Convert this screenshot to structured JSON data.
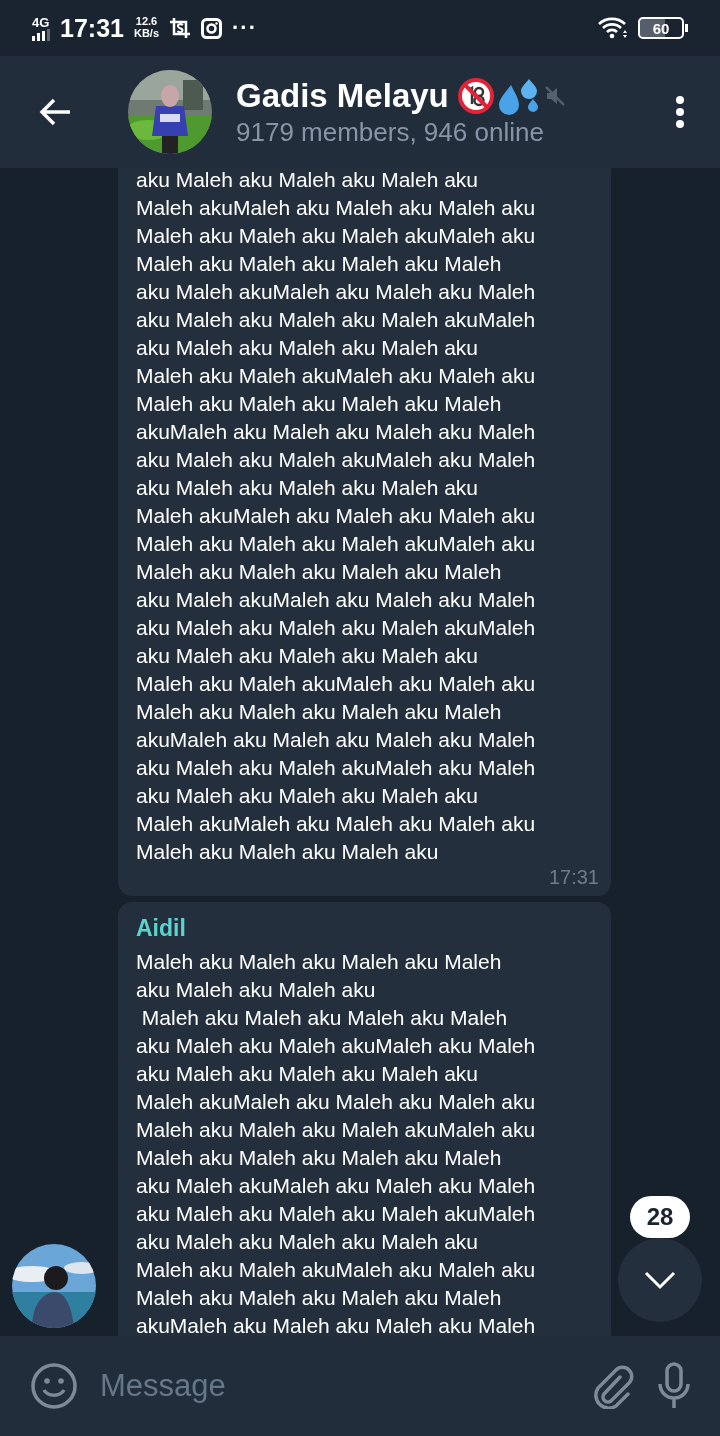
{
  "status_bar": {
    "network": "4G",
    "time": "17:31",
    "speed_value": "12.6",
    "speed_unit": "KB/s",
    "more": "···",
    "battery": "60"
  },
  "header": {
    "title": "Gadis Melayu",
    "subtitle": "9179 members, 946 online",
    "muted": true
  },
  "messages": [
    {
      "lines": [
        "aku Maleh aku Maleh aku Maleh aku",
        "Maleh akuMaleh aku Maleh aku Maleh aku",
        "Maleh aku Maleh aku Maleh akuMaleh aku",
        "Maleh aku Maleh aku Maleh aku Maleh",
        "aku Maleh akuMaleh aku Maleh aku Maleh",
        "aku Maleh aku Maleh aku Maleh akuMaleh",
        "aku Maleh aku Maleh aku Maleh aku",
        "Maleh aku Maleh akuMaleh aku Maleh aku",
        "Maleh aku Maleh aku Maleh aku Maleh",
        "akuMaleh aku Maleh aku Maleh aku Maleh",
        "aku Maleh aku Maleh akuMaleh aku Maleh",
        "aku Maleh aku Maleh aku Maleh aku",
        "Maleh akuMaleh aku Maleh aku Maleh aku",
        "Maleh aku Maleh aku Maleh akuMaleh aku",
        "Maleh aku Maleh aku Maleh aku Maleh",
        "aku Maleh akuMaleh aku Maleh aku Maleh",
        "aku Maleh aku Maleh aku Maleh akuMaleh",
        "aku Maleh aku Maleh aku Maleh aku",
        "Maleh aku Maleh akuMaleh aku Maleh aku",
        "Maleh aku Maleh aku Maleh aku Maleh",
        "akuMaleh aku Maleh aku Maleh aku Maleh",
        "aku Maleh aku Maleh akuMaleh aku Maleh",
        "aku Maleh aku Maleh aku Maleh aku",
        "Maleh akuMaleh aku Maleh aku Maleh aku",
        "Maleh aku Maleh aku Maleh aku"
      ],
      "time": "17:31"
    },
    {
      "sender": "Aidil",
      "lines": [
        "Maleh aku Maleh aku Maleh aku Maleh",
        "aku Maleh aku Maleh aku",
        " Maleh aku Maleh aku Maleh aku Maleh",
        "aku Maleh aku Maleh akuMaleh aku Maleh",
        "aku Maleh aku Maleh aku Maleh aku",
        "Maleh akuMaleh aku Maleh aku Maleh aku",
        "Maleh aku Maleh aku Maleh akuMaleh aku",
        "Maleh aku Maleh aku Maleh aku Maleh",
        "aku Maleh akuMaleh aku Maleh aku Maleh",
        "aku Maleh aku Maleh aku Maleh akuMaleh",
        "aku Maleh aku Maleh aku Maleh aku",
        "Maleh aku Maleh akuMaleh aku Maleh aku",
        "Maleh aku Maleh aku Maleh aku Maleh",
        "akuMaleh aku Maleh aku Maleh aku Maleh"
      ]
    }
  ],
  "scroll_button": {
    "unread_count": "28"
  },
  "composer": {
    "placeholder": "Message"
  }
}
